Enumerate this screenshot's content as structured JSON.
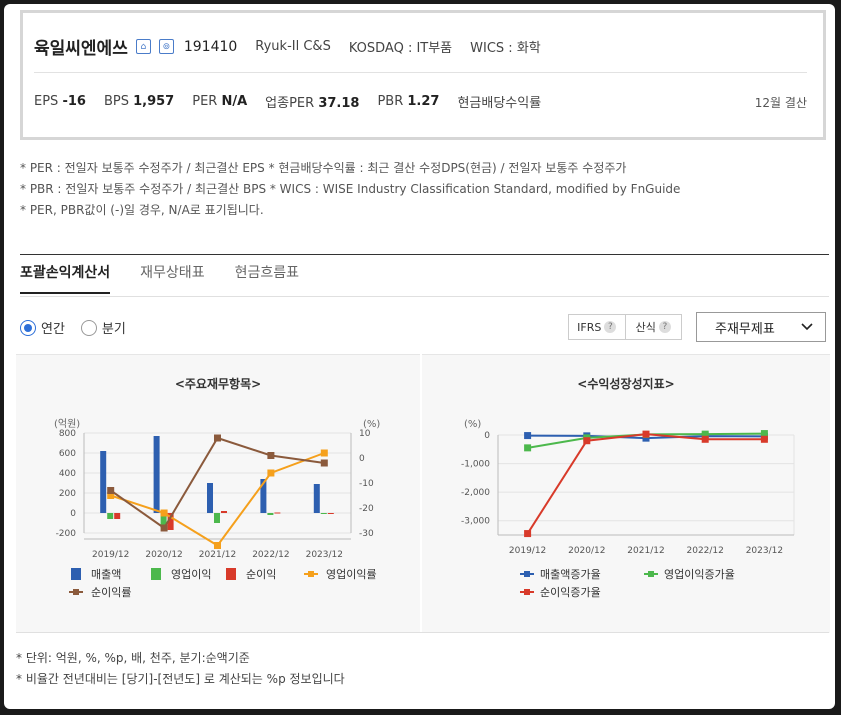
{
  "company": {
    "name": "육일씨엔에쓰",
    "code": "191410",
    "eng_name": "Ryuk-Il C&S",
    "market": "KOSDAQ : IT부품",
    "wics": "WICS : 화학"
  },
  "metrics": {
    "eps_label": "EPS",
    "eps_value": "-16",
    "bps_label": "BPS",
    "bps_value": "1,957",
    "per_label": "PER",
    "per_value": "N/A",
    "sector_per_label": "업종PER",
    "sector_per_value": "37.18",
    "pbr_label": "PBR",
    "pbr_value": "1.27",
    "dividend_label": "현금배당수익률",
    "settlement": "12월 결산"
  },
  "notes": [
    "* PER : 전일자 보통주 수정주가 / 최근결산 EPS * 현금배당수익률 : 최근 결산 수정DPS(현금) / 전일자 보통주 수정주가",
    "* PBR : 전일자 보통주 수정주가 / 최근결산 BPS * WICS : WISE Industry Classification Standard, modified by FnGuide",
    "* PER, PBR값이 (-)일 경우, N/A로 표기됩니다."
  ],
  "tabs": [
    "포괄손익계산서",
    "재무상태표",
    "현금흐름표"
  ],
  "period": {
    "annual": "연간",
    "quarter": "분기"
  },
  "options": {
    "ifrs": "IFRS",
    "calc": "산식",
    "select_value": "주재무제표"
  },
  "chart_data": [
    {
      "type": "bar",
      "title": "<주요재무항목>",
      "y_left_label": "(억원)",
      "y_right_label": "(%)",
      "categories": [
        "2019/12",
        "2020/12",
        "2021/12",
        "2022/12",
        "2023/12"
      ],
      "ylim": [
        -200,
        800
      ],
      "ylim_right": [
        -30,
        10
      ],
      "yticks": [
        "800",
        "600",
        "400",
        "200",
        "0",
        "-200"
      ],
      "yticks_right": [
        "10",
        "0",
        "-10",
        "-20",
        "-30"
      ],
      "series": [
        {
          "name": "매출액",
          "type": "bar",
          "axis": "left",
          "color": "#2d5fb0",
          "values": [
            620,
            770,
            300,
            340,
            290
          ]
        },
        {
          "name": "영업이익",
          "type": "bar",
          "axis": "left",
          "color": "#4cb84c",
          "values": [
            -60,
            -150,
            -100,
            -20,
            -5
          ]
        },
        {
          "name": "순이익",
          "type": "bar",
          "axis": "left",
          "color": "#d83a2a",
          "values": [
            -60,
            -170,
            20,
            5,
            -5
          ]
        },
        {
          "name": "영업이익률",
          "type": "line",
          "axis": "right",
          "color": "#f5a01c",
          "values": [
            -15,
            -22,
            -35,
            -6,
            2
          ]
        },
        {
          "name": "순이익률",
          "type": "line",
          "axis": "right",
          "color": "#8b5a3c",
          "values": [
            -13,
            -28,
            8,
            1,
            -2
          ]
        }
      ]
    },
    {
      "type": "line",
      "title": "<수익성장성지표>",
      "y_label": "(%)",
      "categories": [
        "2019/12",
        "2020/12",
        "2021/12",
        "2022/12",
        "2023/12"
      ],
      "ylim": [
        -3500,
        0
      ],
      "yticks": [
        "0",
        "-1,000",
        "-2,000",
        "-3,000"
      ],
      "series": [
        {
          "name": "매출액증가율",
          "color": "#2d5fb0",
          "values": [
            -20,
            -30,
            -110,
            -40,
            -50
          ]
        },
        {
          "name": "영업이익증가율",
          "color": "#4cb84c",
          "values": [
            -450,
            -100,
            20,
            30,
            50
          ]
        },
        {
          "name": "순이익증가율",
          "color": "#d83a2a",
          "values": [
            -3450,
            -200,
            30,
            -150,
            -150
          ]
        }
      ]
    }
  ],
  "footer": [
    "* 단위: 억원, %, %p, 배, 천주, 분기:순액기준",
    "* 비율간 전년대비는 [당기]-[전년도] 로 계산되는 %p 정보입니다"
  ]
}
